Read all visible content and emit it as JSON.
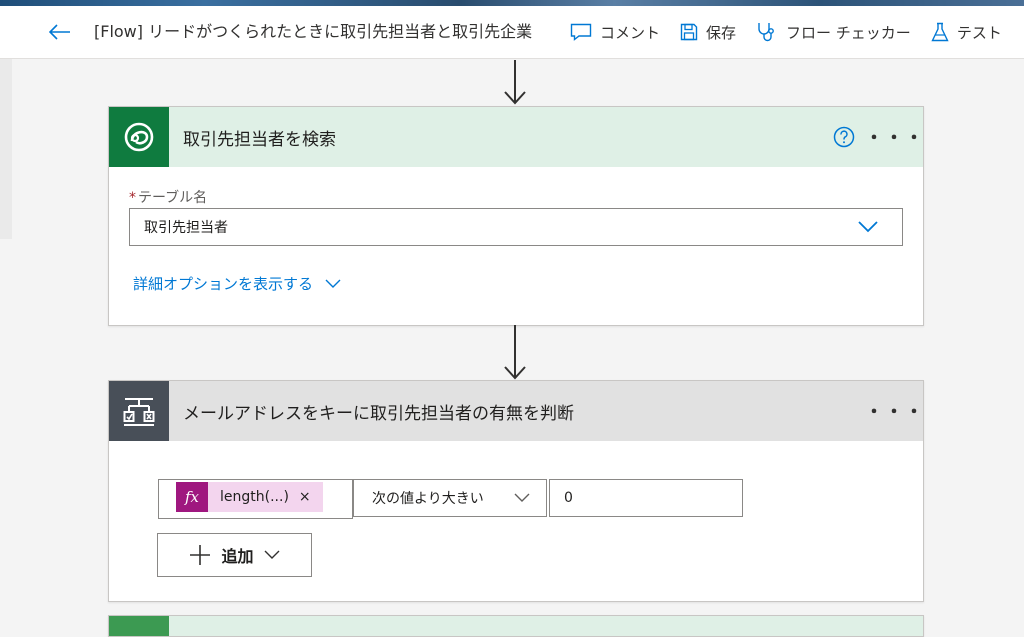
{
  "header": {
    "title": "[Flow] リードがつくられたときに取引先担当者と取引先企業",
    "actions": [
      {
        "label": "コメント",
        "icon": "comment-icon"
      },
      {
        "label": "保存",
        "icon": "save-icon"
      },
      {
        "label": "フロー チェッカー",
        "icon": "stethoscope-icon"
      },
      {
        "label": "テスト",
        "icon": "flask-icon"
      }
    ]
  },
  "step1": {
    "title": "取引先担当者を検索",
    "icon": "dataverse-icon",
    "header_color": "#dff0e6",
    "icon_bg": "#0f7b3f",
    "field_label": "テーブル名",
    "required_mark": "*",
    "field_value": "取引先担当者",
    "advanced_link": "詳細オプションを表示する"
  },
  "step2": {
    "title": "メールアドレスをキーに取引先担当者の有無を判断",
    "icon": "condition-icon",
    "header_color": "#e1e1e1",
    "icon_bg": "#484f58",
    "condition": {
      "expression_label": "length(...)",
      "fx_label": "fx",
      "remove_label": "×",
      "operator": "次の値より大きい",
      "value": "0"
    },
    "add_label": "追加"
  },
  "more_label": "・・・"
}
